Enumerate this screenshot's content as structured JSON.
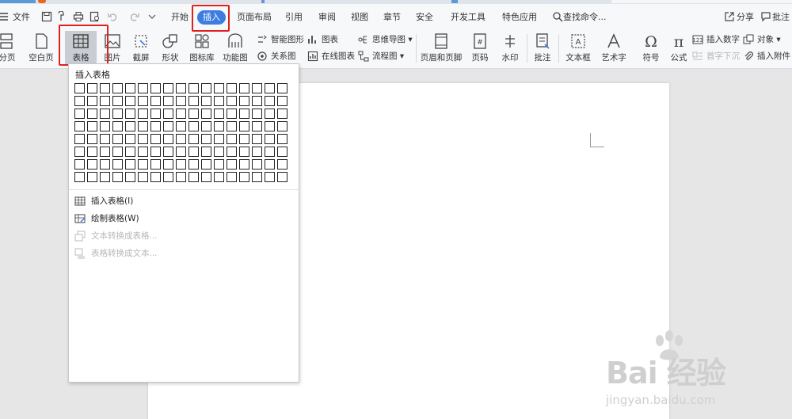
{
  "menubar": {
    "file": "文件",
    "tabs": [
      "开始",
      "插入",
      "页面布局",
      "引用",
      "审阅",
      "视图",
      "章节",
      "安全",
      "开发工具",
      "特色应用"
    ],
    "active_tab": "插入",
    "search": "查找命令...",
    "share": "分享",
    "comment": "批注"
  },
  "ribbon": {
    "page_break": "分页",
    "blank_page": "空白页",
    "table": "表格",
    "picture": "图片",
    "screenshot": "截屏",
    "shape": "形状",
    "icon_lib": "图标库",
    "func_chart": "功能图",
    "smart_art": "智能图形",
    "chart": "图表",
    "mind_map": "思维导图",
    "relation": "关系图",
    "online_chart": "在线图表",
    "flow_chart": "流程图",
    "header_footer": "页眉和页脚",
    "page_num": "页码",
    "watermark": "水印",
    "annotation": "批注",
    "textbox": "文本框",
    "wordart": "艺术字",
    "symbol": "符号",
    "formula": "公式",
    "insert_number": "插入数字",
    "object": "对象",
    "drop_cap": "首字下沉",
    "attachment": "插入附件"
  },
  "dropdown": {
    "title": "插入表格",
    "items": [
      "插入表格(I)",
      "绘制表格(W)",
      "文本转换成表格...",
      "表格转换成文本..."
    ]
  },
  "watermark": {
    "brand": "Bai 经验",
    "url": "jingyan.baidu.com"
  },
  "colors": {
    "accent": "#3d7de2",
    "highlight": "#e0201f"
  }
}
